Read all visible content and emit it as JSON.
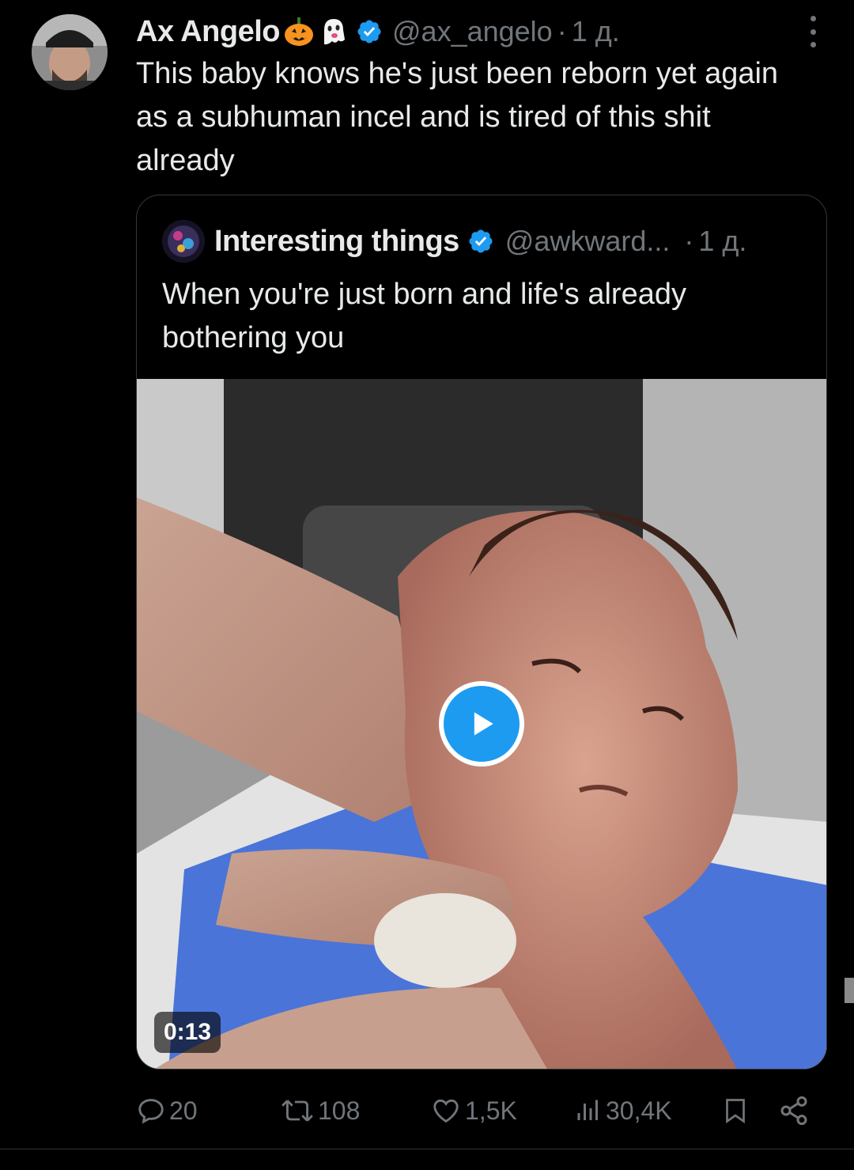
{
  "author": {
    "name": "Ax Angelo",
    "handle": "@ax_angelo",
    "separator": "·",
    "time": "1 д.",
    "emojis": [
      "pumpkin-emoji",
      "ghost-emoji"
    ],
    "verified": true
  },
  "tweet": {
    "text": "This baby knows he's just been reborn yet again as a subhuman incel and is tired of this shit already"
  },
  "quoted": {
    "name": "Interesting things",
    "handle": "@awkward...",
    "separator": "·",
    "time": "1 д.",
    "text": "When you're just born and life's already bothering you",
    "video_duration": "0:13",
    "verified": true
  },
  "actions": {
    "replies": "20",
    "reposts": "108",
    "likes": "1,5K",
    "views": "30,4K"
  },
  "colors": {
    "background": "#000000",
    "text": "#e7e9ea",
    "muted": "#71767b",
    "accent": "#1d9bf0",
    "border": "#333639"
  }
}
